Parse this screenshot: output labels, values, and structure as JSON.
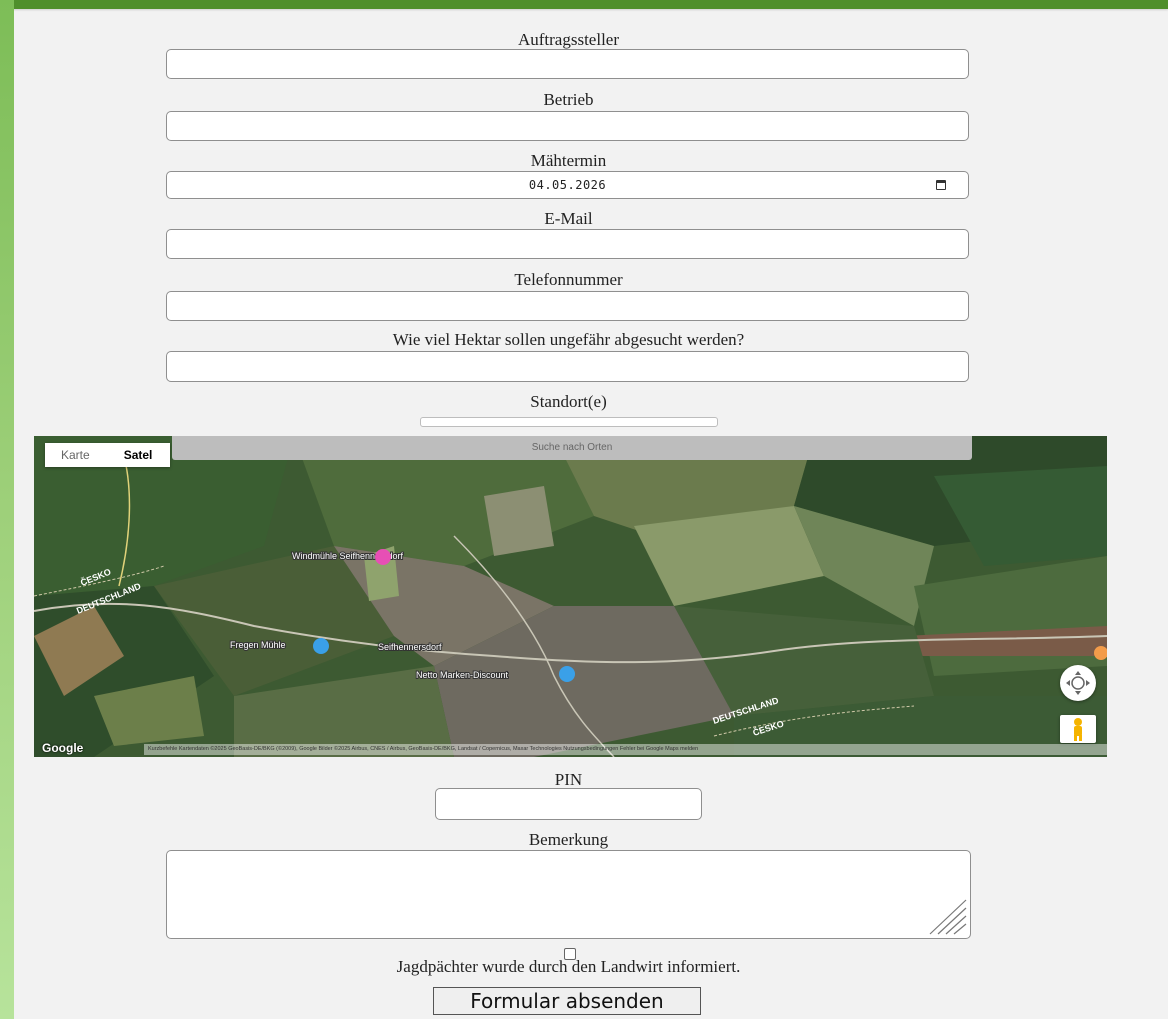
{
  "form": {
    "auftraggeber_label": "Auftragssteller",
    "betrieb_label": "Betrieb",
    "maehtermin_label": "Mähtermin",
    "maehtermin_value": "04.05.2026",
    "email_label": "E-Mail",
    "telefon_label": "Telefonnummer",
    "hektar_label": "Wie viel Hektar sollen ungefähr abgesucht werden?",
    "standort_label": "Standort(e)",
    "pin_label": "PIN",
    "bemerkung_label": "Bemerkung",
    "jagd_label": "Jagdpächter wurde durch den Landwirt informiert.",
    "submit_label": "Formular absenden"
  },
  "map": {
    "maptype_karte": "Karte",
    "maptype_satellit": "Satel",
    "search_placeholder": "Suche nach Orten",
    "labels": {
      "cesko_1": "ČESKO",
      "deutschland_1": "DEUTSCHLAND",
      "windmuehle": "Windmühle Seifhennersdorf",
      "seifhennersdorf": "Seifhennersdorf",
      "freigut": "Fregen Mühle",
      "markt": "Netto Marken-Discount",
      "deutschland_2": "DEUTSCHLAND",
      "cesko_2": "ČESKO"
    },
    "google": "Google",
    "attribution": "Kurzbefehle  Kartendaten ©2025 GeoBasis-DE/BKG (©2009), Google Bilder ©2025 Airbus, CNES / Airbus, GeoBasis-DE/BKG, Landsat / Copernicus, Maxar Technologies   Nutzungsbedingungen   Fehler bei Google Maps melden"
  },
  "colors": {
    "accent_green": "#4f8f2c",
    "sidebar_green": "#9ed07a",
    "page_bg": "#f2f2f2"
  }
}
